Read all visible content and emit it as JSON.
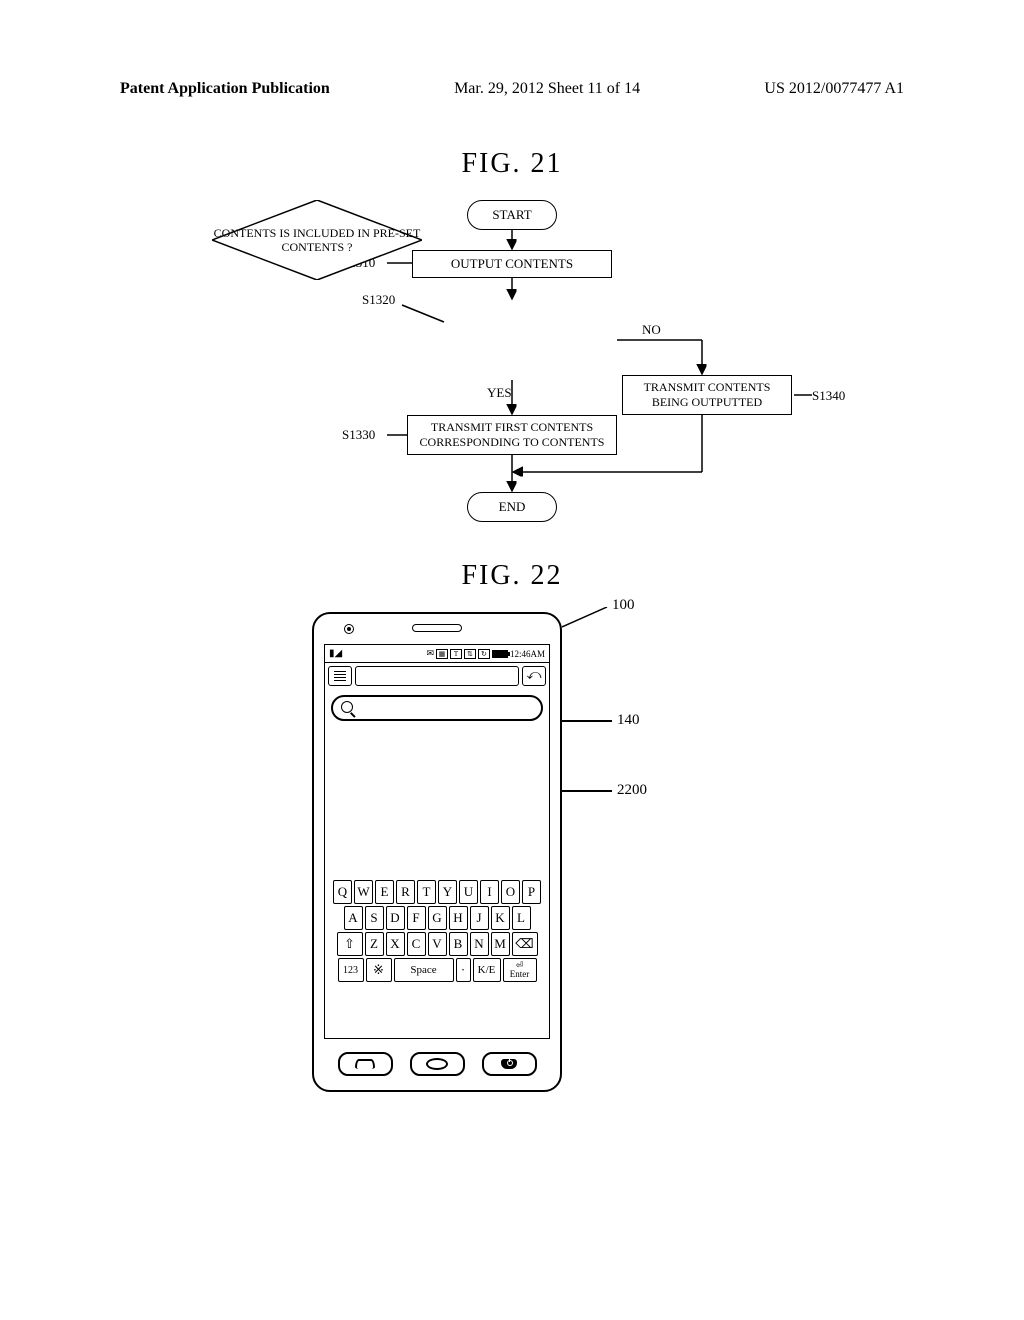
{
  "header": {
    "left": "Patent Application Publication",
    "center": "Mar. 29, 2012  Sheet 11 of 14",
    "right": "US 2012/0077477 A1"
  },
  "fig21": {
    "title": "FIG.  21",
    "start": "START",
    "s1310": {
      "label": "S1310",
      "text": "OUTPUT CONTENTS"
    },
    "s1320": {
      "label": "S1320",
      "text": "CONTENTS IS INCLUDED IN PRE-SET CONTENTS ?"
    },
    "s1330": {
      "label": "S1330",
      "text": "TRANSMIT FIRST CONTENTS CORRESPONDING TO CONTENTS"
    },
    "s1340": {
      "label": "S1340",
      "text": "TRANSMIT CONTENTS BEING OUTPUTTED"
    },
    "yes": "YES",
    "no": "NO",
    "end": "END"
  },
  "fig22": {
    "title": "FIG.  22",
    "ref100": "100",
    "ref140": "140",
    "ref2200": "2200",
    "status_time": "12:46AM",
    "keys": {
      "row1": [
        "Q",
        "W",
        "E",
        "R",
        "T",
        "Y",
        "U",
        "I",
        "O",
        "P"
      ],
      "row2": [
        "A",
        "S",
        "D",
        "F",
        "G",
        "H",
        "J",
        "K",
        "L"
      ],
      "row3_shift": "⇧",
      "row3": [
        "Z",
        "X",
        "C",
        "V",
        "B",
        "N",
        "M"
      ],
      "row3_back": "⌫",
      "row4_123": "123",
      "row4_gear": "※",
      "row4_space": "Space",
      "row4_dot": "·",
      "row4_ke": "K/E",
      "row4_enter_sym": "⏎",
      "row4_enter": "Enter"
    }
  }
}
